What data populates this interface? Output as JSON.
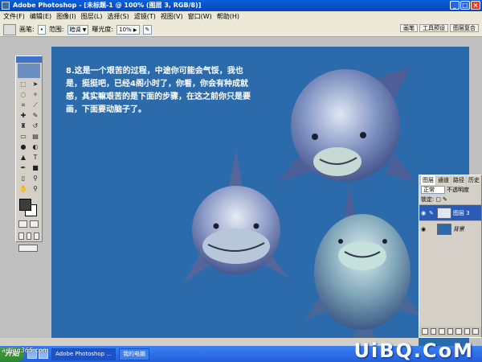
{
  "window": {
    "title": "Adobe Photoshop - [未标题-1 @ 100% (图层 3, RGB/8)]",
    "controls": [
      "_",
      "□",
      "×"
    ]
  },
  "menu": [
    "文件(F)",
    "编辑(E)",
    "图像(I)",
    "图层(L)",
    "选择(S)",
    "滤镜(T)",
    "视图(V)",
    "窗口(W)",
    "帮助(H)"
  ],
  "options": {
    "brush_label": "画笔:",
    "range_label": "范围:",
    "range_value": "暗调",
    "exposure_label": "曝光度:",
    "exposure_value": "10%"
  },
  "palette_well": [
    "画笔",
    "工具预设",
    "图层复合"
  ],
  "canvas_text": "8.这是一个艰苦的过程，中途你可能会气馁，我也是，挺挺吧，已经4阁小时了，你看，你会有种成就感，其实嘛艰苦的是下面的步骤，在这之前你只是要画，下面要动脑子了。",
  "layers_panel": {
    "tabs": [
      "图层",
      "通道",
      "路径",
      "历史"
    ],
    "blend_mode": "正常",
    "opacity_label": "不透明度",
    "lock_label": "锁定:",
    "layers": [
      {
        "name": "图层 3",
        "selected": true
      },
      {
        "name": "背景",
        "selected": false
      }
    ]
  },
  "taskbar": {
    "start": "开始",
    "tasks": [
      "Adobe Photoshop ...",
      "我的电脑"
    ]
  },
  "watermarks": {
    "site": "arting365.com",
    "brand": "UiBQ.CoM"
  },
  "colors": {
    "canvas": "#2c6bab",
    "foreground": "#3d3d3d",
    "background": "#ffffff"
  }
}
